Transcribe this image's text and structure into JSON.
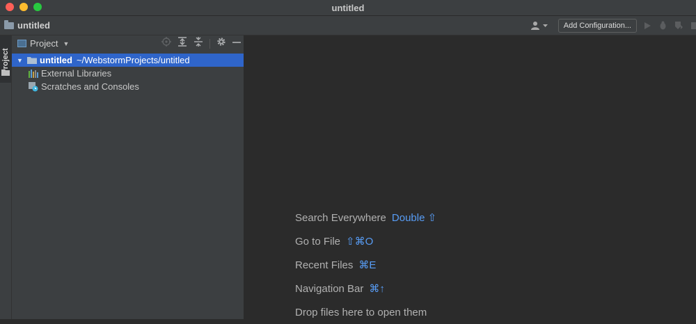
{
  "window": {
    "title": "untitled"
  },
  "navbar": {
    "crumb": "untitled",
    "add_configuration": "Add Configuration..."
  },
  "left_strip": {
    "tab_label": "Project"
  },
  "panel": {
    "title": "Project",
    "tree": {
      "root": {
        "name": "untitled",
        "path": "~/WebstormProjects/untitled"
      },
      "items": [
        {
          "label": "External Libraries",
          "icon": "library-icon"
        },
        {
          "label": "Scratches and Consoles",
          "icon": "scratches-icon"
        }
      ]
    }
  },
  "editor": {
    "hints": [
      {
        "label": "Search Everywhere",
        "shortcut": "Double ⇧"
      },
      {
        "label": "Go to File",
        "shortcut": "⇧⌘O"
      },
      {
        "label": "Recent Files",
        "shortcut": "⌘E"
      },
      {
        "label": "Navigation Bar",
        "shortcut": "⌘↑"
      },
      {
        "label": "Drop files here to open them",
        "shortcut": ""
      }
    ]
  },
  "colors": {
    "selection": "#2f65ca",
    "shortcut": "#589df6",
    "panel_bg": "#3c3f41",
    "editor_bg": "#2b2b2b"
  }
}
